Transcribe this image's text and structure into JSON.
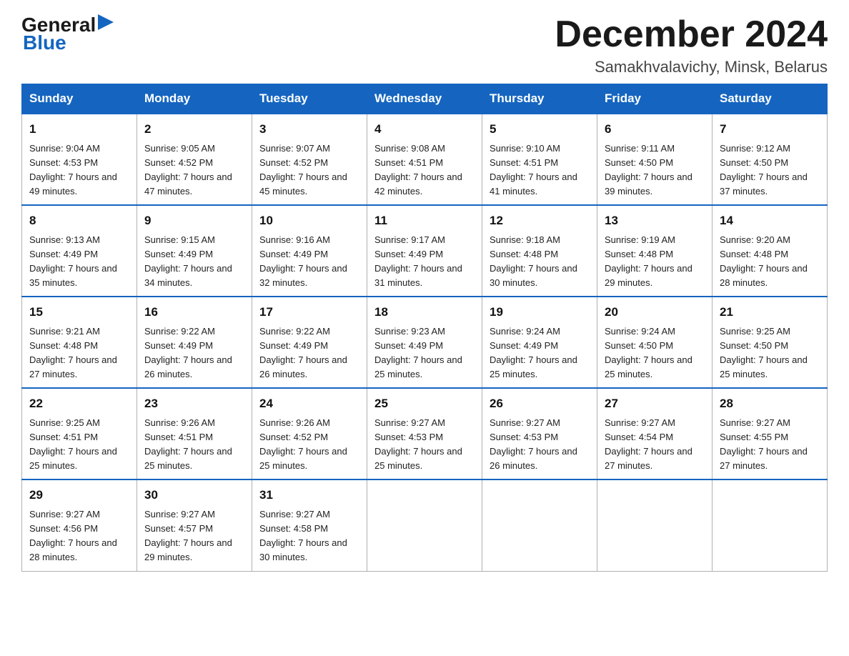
{
  "logo": {
    "general": "General",
    "arrow": "▶",
    "blue": "Blue"
  },
  "header": {
    "month_title": "December 2024",
    "location": "Samakhvalavichy, Minsk, Belarus"
  },
  "weekdays": [
    "Sunday",
    "Monday",
    "Tuesday",
    "Wednesday",
    "Thursday",
    "Friday",
    "Saturday"
  ],
  "weeks": [
    [
      {
        "day": "1",
        "sunrise": "9:04 AM",
        "sunset": "4:53 PM",
        "daylight": "7 hours and 49 minutes."
      },
      {
        "day": "2",
        "sunrise": "9:05 AM",
        "sunset": "4:52 PM",
        "daylight": "7 hours and 47 minutes."
      },
      {
        "day": "3",
        "sunrise": "9:07 AM",
        "sunset": "4:52 PM",
        "daylight": "7 hours and 45 minutes."
      },
      {
        "day": "4",
        "sunrise": "9:08 AM",
        "sunset": "4:51 PM",
        "daylight": "7 hours and 42 minutes."
      },
      {
        "day": "5",
        "sunrise": "9:10 AM",
        "sunset": "4:51 PM",
        "daylight": "7 hours and 41 minutes."
      },
      {
        "day": "6",
        "sunrise": "9:11 AM",
        "sunset": "4:50 PM",
        "daylight": "7 hours and 39 minutes."
      },
      {
        "day": "7",
        "sunrise": "9:12 AM",
        "sunset": "4:50 PM",
        "daylight": "7 hours and 37 minutes."
      }
    ],
    [
      {
        "day": "8",
        "sunrise": "9:13 AM",
        "sunset": "4:49 PM",
        "daylight": "7 hours and 35 minutes."
      },
      {
        "day": "9",
        "sunrise": "9:15 AM",
        "sunset": "4:49 PM",
        "daylight": "7 hours and 34 minutes."
      },
      {
        "day": "10",
        "sunrise": "9:16 AM",
        "sunset": "4:49 PM",
        "daylight": "7 hours and 32 minutes."
      },
      {
        "day": "11",
        "sunrise": "9:17 AM",
        "sunset": "4:49 PM",
        "daylight": "7 hours and 31 minutes."
      },
      {
        "day": "12",
        "sunrise": "9:18 AM",
        "sunset": "4:48 PM",
        "daylight": "7 hours and 30 minutes."
      },
      {
        "day": "13",
        "sunrise": "9:19 AM",
        "sunset": "4:48 PM",
        "daylight": "7 hours and 29 minutes."
      },
      {
        "day": "14",
        "sunrise": "9:20 AM",
        "sunset": "4:48 PM",
        "daylight": "7 hours and 28 minutes."
      }
    ],
    [
      {
        "day": "15",
        "sunrise": "9:21 AM",
        "sunset": "4:48 PM",
        "daylight": "7 hours and 27 minutes."
      },
      {
        "day": "16",
        "sunrise": "9:22 AM",
        "sunset": "4:49 PM",
        "daylight": "7 hours and 26 minutes."
      },
      {
        "day": "17",
        "sunrise": "9:22 AM",
        "sunset": "4:49 PM",
        "daylight": "7 hours and 26 minutes."
      },
      {
        "day": "18",
        "sunrise": "9:23 AM",
        "sunset": "4:49 PM",
        "daylight": "7 hours and 25 minutes."
      },
      {
        "day": "19",
        "sunrise": "9:24 AM",
        "sunset": "4:49 PM",
        "daylight": "7 hours and 25 minutes."
      },
      {
        "day": "20",
        "sunrise": "9:24 AM",
        "sunset": "4:50 PM",
        "daylight": "7 hours and 25 minutes."
      },
      {
        "day": "21",
        "sunrise": "9:25 AM",
        "sunset": "4:50 PM",
        "daylight": "7 hours and 25 minutes."
      }
    ],
    [
      {
        "day": "22",
        "sunrise": "9:25 AM",
        "sunset": "4:51 PM",
        "daylight": "7 hours and 25 minutes."
      },
      {
        "day": "23",
        "sunrise": "9:26 AM",
        "sunset": "4:51 PM",
        "daylight": "7 hours and 25 minutes."
      },
      {
        "day": "24",
        "sunrise": "9:26 AM",
        "sunset": "4:52 PM",
        "daylight": "7 hours and 25 minutes."
      },
      {
        "day": "25",
        "sunrise": "9:27 AM",
        "sunset": "4:53 PM",
        "daylight": "7 hours and 25 minutes."
      },
      {
        "day": "26",
        "sunrise": "9:27 AM",
        "sunset": "4:53 PM",
        "daylight": "7 hours and 26 minutes."
      },
      {
        "day": "27",
        "sunrise": "9:27 AM",
        "sunset": "4:54 PM",
        "daylight": "7 hours and 27 minutes."
      },
      {
        "day": "28",
        "sunrise": "9:27 AM",
        "sunset": "4:55 PM",
        "daylight": "7 hours and 27 minutes."
      }
    ],
    [
      {
        "day": "29",
        "sunrise": "9:27 AM",
        "sunset": "4:56 PM",
        "daylight": "7 hours and 28 minutes."
      },
      {
        "day": "30",
        "sunrise": "9:27 AM",
        "sunset": "4:57 PM",
        "daylight": "7 hours and 29 minutes."
      },
      {
        "day": "31",
        "sunrise": "9:27 AM",
        "sunset": "4:58 PM",
        "daylight": "7 hours and 30 minutes."
      },
      null,
      null,
      null,
      null
    ]
  ]
}
